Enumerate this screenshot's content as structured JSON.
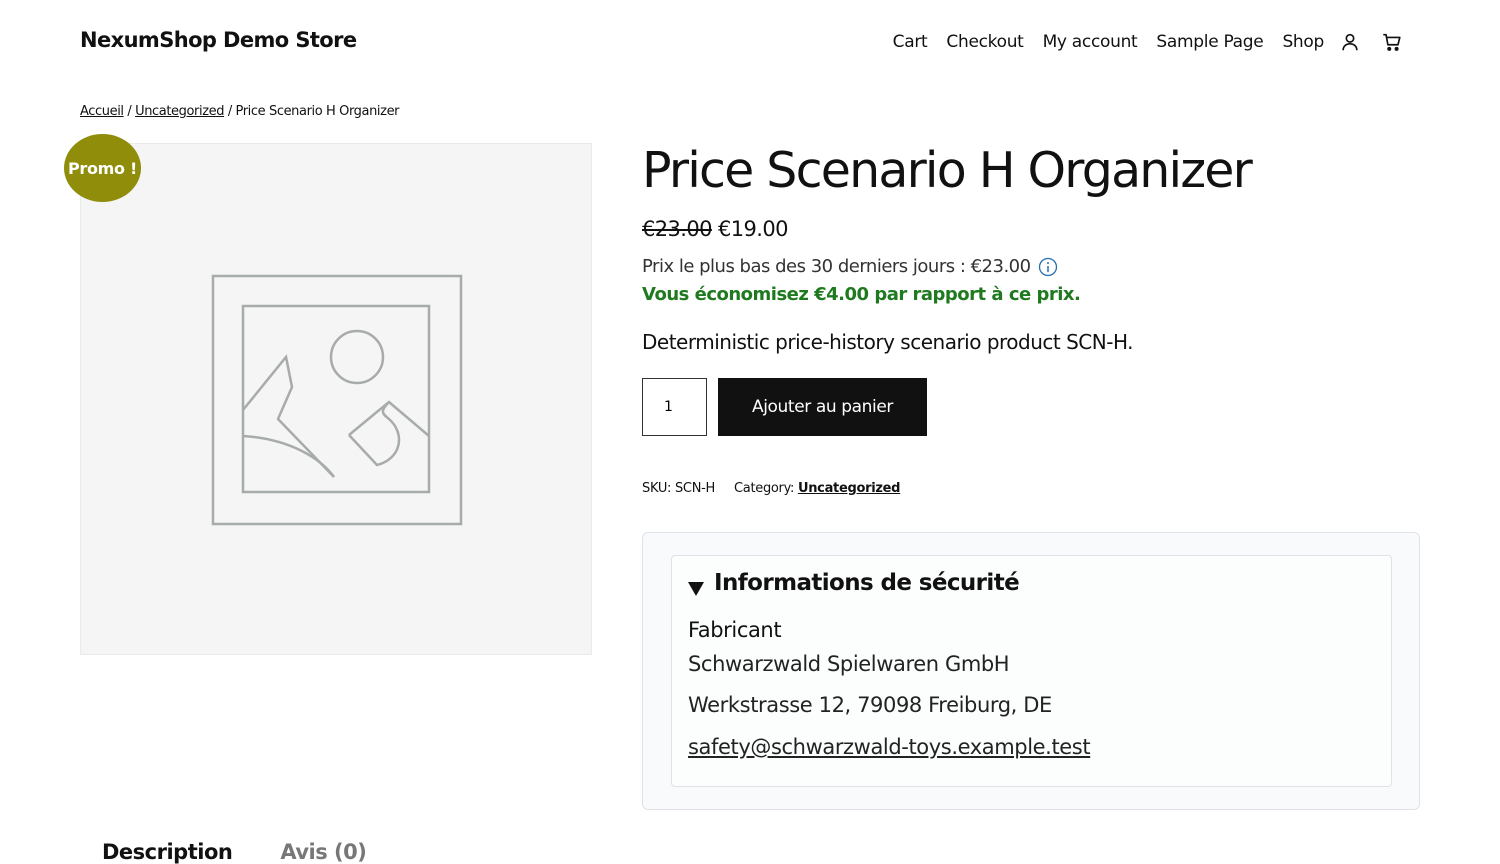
{
  "header": {
    "site_title": "NexumShop Demo Store",
    "nav": [
      "Cart",
      "Checkout",
      "My account",
      "Sample Page",
      "Shop"
    ],
    "icons": [
      "user-icon",
      "cart-icon"
    ]
  },
  "breadcrumb": {
    "home": "Accueil",
    "sep": "/",
    "category": "Uncategorized",
    "current": "Price Scenario H Organizer"
  },
  "gallery": {
    "badge": "Promo !",
    "placeholder_icon": "image-placeholder-icon"
  },
  "product": {
    "title": "Price Scenario H Organizer",
    "regular_price": "€23.00",
    "sale_price": "€19.00",
    "lowest_price_text": "Prix le plus bas des 30 derniers jours : €23.00",
    "savings_text": "Vous économisez €4.00 par rapport à ce prix.",
    "short_description": "Deterministic price-history scenario product SCN-H.",
    "quantity": "1",
    "add_to_cart": "Ajouter au panier",
    "sku_label": "SKU:",
    "sku": "SCN-H",
    "category_label": "Category:",
    "category": "Uncategorized"
  },
  "safety": {
    "summary": "Informations de sécurité",
    "manufacturer_label": "Fabricant",
    "manufacturer_name": "Schwarzwald Spielwaren GmbH",
    "address": "Werkstrasse 12, 79098 Freiburg, DE",
    "email": "safety@schwarzwald-toys.example.test"
  },
  "tabs": [
    "Description",
    "Avis (0)"
  ],
  "colors": {
    "badge": "#8f8d0a",
    "savings": "#1f7a1f",
    "button": "#111111",
    "info_icon": "#2a6fb0"
  }
}
